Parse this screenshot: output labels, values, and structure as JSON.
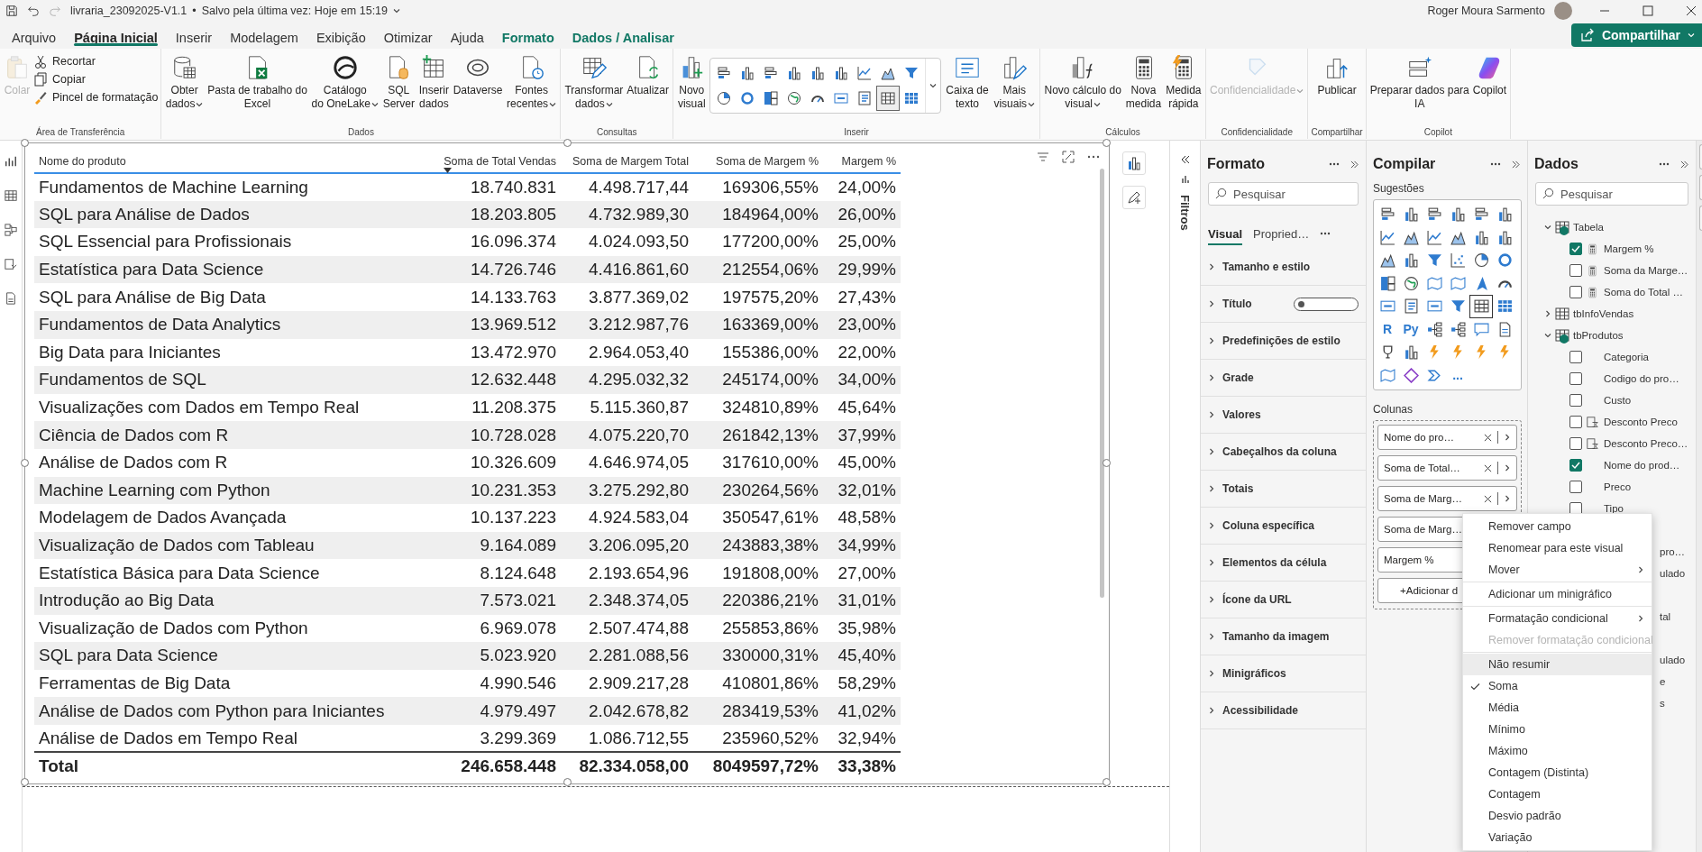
{
  "title_bar": {
    "file_name": "livraria_23092025-V1.1",
    "separator": "•",
    "saved_status": "Salvo pela última vez: Hoje em 15:19",
    "user_name": "Roger Moura Sarmento"
  },
  "menu_tabs": [
    {
      "label": "Arquivo",
      "selected": false,
      "kind": "tab"
    },
    {
      "label": "Página Inicial",
      "selected": true,
      "kind": "tab"
    },
    {
      "label": "Inserir",
      "selected": false,
      "kind": "tab"
    },
    {
      "label": "Modelagem",
      "selected": false,
      "kind": "tab"
    },
    {
      "label": "Exibição",
      "selected": false,
      "kind": "tab"
    },
    {
      "label": "Otimizar",
      "selected": false,
      "kind": "tab"
    },
    {
      "label": "Ajuda",
      "selected": false,
      "kind": "tab"
    },
    {
      "label": "Formato",
      "selected": false,
      "kind": "context"
    },
    {
      "label": "Dados / Analisar",
      "selected": false,
      "kind": "context"
    }
  ],
  "share_button": {
    "label": "Compartilhar"
  },
  "ribbon": {
    "groups": [
      {
        "label": "Área de Transferência",
        "items": [
          {
            "kind": "large",
            "lines": [
              "Colar"
            ],
            "dropdown": false,
            "disabled": true
          },
          {
            "kind": "small",
            "lines": [
              "Recortar"
            ],
            "dropdown": false,
            "disabled": false
          },
          {
            "kind": "small",
            "lines": [
              "Copiar"
            ],
            "dropdown": false,
            "disabled": false
          },
          {
            "kind": "small",
            "lines": [
              "Pincel de formatação"
            ],
            "dropdown": false,
            "disabled": false
          }
        ]
      },
      {
        "label": "Dados",
        "items": [
          {
            "kind": "large",
            "lines": [
              "Obter",
              "dados"
            ],
            "dropdown": true,
            "disabled": false
          },
          {
            "kind": "large",
            "lines": [
              "Pasta de trabalho do",
              "Excel"
            ],
            "dropdown": false,
            "disabled": false
          },
          {
            "kind": "large",
            "lines": [
              "Catálogo",
              "do OneLake"
            ],
            "dropdown": true,
            "disabled": false
          },
          {
            "kind": "large",
            "lines": [
              "SQL",
              "Server"
            ],
            "dropdown": false,
            "disabled": false
          },
          {
            "kind": "large",
            "lines": [
              "Inserir",
              "dados"
            ],
            "dropdown": false,
            "disabled": false
          },
          {
            "kind": "large",
            "lines": [
              "Dataverse"
            ],
            "dropdown": false,
            "disabled": false
          },
          {
            "kind": "large",
            "lines": [
              "Fontes",
              "recentes"
            ],
            "dropdown": true,
            "disabled": false
          }
        ]
      },
      {
        "label": "Consultas",
        "items": [
          {
            "kind": "large",
            "lines": [
              "Transformar",
              "dados"
            ],
            "dropdown": true,
            "disabled": false
          },
          {
            "kind": "large",
            "lines": [
              "Atualizar"
            ],
            "dropdown": false,
            "disabled": false
          }
        ]
      },
      {
        "label": "Inserir",
        "items": [
          {
            "kind": "large",
            "lines": [
              "Novo",
              "visual"
            ],
            "dropdown": false,
            "disabled": false
          },
          {
            "kind": "gallery",
            "dropdown": true,
            "disabled": false,
            "visuals": [
              {
                "selected": false
              },
              {
                "selected": false
              },
              {
                "selected": false
              },
              {
                "selected": false
              },
              {
                "selected": false
              },
              {
                "selected": false
              },
              {
                "selected": false
              },
              {
                "selected": false
              },
              {
                "selected": false
              },
              {
                "selected": false
              },
              {
                "selected": false
              },
              {
                "selected": false
              },
              {
                "selected": false
              },
              {
                "selected": false
              },
              {
                "selected": false
              },
              {
                "selected": false
              },
              {
                "selected": true
              },
              {
                "selected": false
              }
            ]
          },
          {
            "kind": "large",
            "lines": [
              "Caixa de",
              "texto"
            ],
            "dropdown": false,
            "disabled": false
          },
          {
            "kind": "large",
            "lines": [
              "Mais",
              "visuais"
            ],
            "dropdown": true,
            "disabled": false
          }
        ]
      },
      {
        "label": "Cálculos",
        "items": [
          {
            "kind": "large",
            "lines": [
              "Novo cálculo do",
              "visual"
            ],
            "dropdown": true,
            "disabled": false
          },
          {
            "kind": "large",
            "lines": [
              "Nova",
              "medida"
            ],
            "dropdown": false,
            "disabled": false
          },
          {
            "kind": "large",
            "lines": [
              "Medida",
              "rápida"
            ],
            "dropdown": false,
            "disabled": false
          }
        ]
      },
      {
        "label": "Confidencialidade",
        "items": [
          {
            "kind": "large",
            "lines": [
              "Confidencialidade"
            ],
            "dropdown": true,
            "disabled": true
          }
        ]
      },
      {
        "label": "Compartilhar",
        "items": [
          {
            "kind": "large",
            "lines": [
              "Publicar"
            ],
            "dropdown": false,
            "disabled": false
          }
        ]
      },
      {
        "label": "Copilot",
        "items": [
          {
            "kind": "large",
            "lines": [
              "Preparar dados para",
              "IA"
            ],
            "dropdown": false,
            "disabled": false
          },
          {
            "kind": "large",
            "lines": [
              "Copilot"
            ],
            "dropdown": false,
            "disabled": false
          }
        ]
      }
    ]
  },
  "table_visual": {
    "columns": [
      {
        "label": "Nome do produto",
        "sorted": false
      },
      {
        "label": "Soma de Total Vendas",
        "sorted": true
      },
      {
        "label": "Soma de Margem Total",
        "sorted": false
      },
      {
        "label": "Soma de Margem %",
        "sorted": false
      },
      {
        "label": "Margem %",
        "sorted": false
      }
    ],
    "rows": [
      [
        "Fundamentos de Machine Learning",
        "18.740.831",
        "4.498.717,44",
        "169306,55%",
        "24,00%"
      ],
      [
        "SQL para Análise de Dados",
        "18.203.805",
        "4.732.989,30",
        "184964,00%",
        "26,00%"
      ],
      [
        "SQL Essencial para Profissionais",
        "16.096.374",
        "4.024.093,50",
        "177200,00%",
        "25,00%"
      ],
      [
        "Estatística para Data Science",
        "14.726.746",
        "4.416.861,60",
        "212554,06%",
        "29,99%"
      ],
      [
        "SQL para Análise de Big Data",
        "14.133.763",
        "3.877.369,02",
        "197575,20%",
        "27,43%"
      ],
      [
        "Fundamentos de Data Analytics",
        "13.969.512",
        "3.212.987,76",
        "163369,00%",
        "23,00%"
      ],
      [
        "Big Data para Iniciantes",
        "13.472.970",
        "2.964.053,40",
        "155386,00%",
        "22,00%"
      ],
      [
        "Fundamentos de SQL",
        "12.632.448",
        "4.295.032,32",
        "245174,00%",
        "34,00%"
      ],
      [
        "Visualizações com Dados em Tempo Real",
        "11.208.375",
        "5.115.360,87",
        "324810,89%",
        "45,64%"
      ],
      [
        "Ciência de Dados com R",
        "10.728.028",
        "4.075.220,70",
        "261842,13%",
        "37,99%"
      ],
      [
        "Análise de Dados com R",
        "10.326.609",
        "4.646.974,05",
        "317610,00%",
        "45,00%"
      ],
      [
        "Machine Learning com Python",
        "10.231.353",
        "3.275.292,80",
        "230264,56%",
        "32,01%"
      ],
      [
        "Modelagem de Dados Avançada",
        "10.137.223",
        "4.924.583,04",
        "350547,61%",
        "48,58%"
      ],
      [
        "Visualização de Dados com Tableau",
        "9.164.089",
        "3.206.095,20",
        "243883,38%",
        "34,99%"
      ],
      [
        "Estatística Básica para Data Science",
        "8.124.648",
        "2.193.654,96",
        "191808,00%",
        "27,00%"
      ],
      [
        "Introdução ao Big Data",
        "7.573.021",
        "2.348.374,05",
        "220386,21%",
        "31,01%"
      ],
      [
        "Visualização de Dados com Python",
        "6.969.078",
        "2.507.474,88",
        "255853,86%",
        "35,98%"
      ],
      [
        "SQL para Data Science",
        "5.023.920",
        "2.281.088,56",
        "330000,31%",
        "45,40%"
      ],
      [
        "Ferramentas de Big Data",
        "4.990.546",
        "2.909.217,28",
        "410801,86%",
        "58,29%"
      ],
      [
        "Análise de Dados com Python para Iniciantes",
        "4.979.497",
        "2.042.678,82",
        "283419,53%",
        "41,02%"
      ],
      [
        "Análise de Dados em Tempo Real",
        "3.299.369",
        "1.086.712,55",
        "235960,52%",
        "32,94%"
      ]
    ],
    "total": [
      "Total",
      "246.658.448",
      "82.334.058,00",
      "8049597,72%",
      "33,38%"
    ]
  },
  "filters_pane": {
    "label": "Filtros"
  },
  "format_pane": {
    "title": "Formato",
    "search_placeholder": "Pesquisar",
    "tabs": [
      {
        "label": "Visual",
        "selected": true
      },
      {
        "label": "Propried…",
        "selected": false
      }
    ],
    "sections": [
      {
        "label": "Tamanho e estilo",
        "kind": "section"
      },
      {
        "label": "Título",
        "kind": "toggle",
        "on": false
      },
      {
        "label": "Predefinições de estilo",
        "kind": "section"
      },
      {
        "label": "Grade",
        "kind": "section"
      },
      {
        "label": "Valores",
        "kind": "section"
      },
      {
        "label": "Cabeçalhos da coluna",
        "kind": "section"
      },
      {
        "label": "Totais",
        "kind": "section"
      },
      {
        "label": "Coluna específica",
        "kind": "section"
      },
      {
        "label": "Elementos da célula",
        "kind": "section"
      },
      {
        "label": "Ícone da URL",
        "kind": "section"
      },
      {
        "label": "Tamanho da imagem",
        "kind": "section"
      },
      {
        "label": "Minigráficos",
        "kind": "section"
      },
      {
        "label": "Acessibilidade",
        "kind": "section"
      }
    ]
  },
  "build_pane": {
    "title": "Compilar",
    "suggestions_label": "Sugestões",
    "visuals": [
      {
        "selected": false
      },
      {
        "selected": false
      },
      {
        "selected": false
      },
      {
        "selected": false
      },
      {
        "selected": false
      },
      {
        "selected": false
      },
      {
        "selected": false
      },
      {
        "selected": false
      },
      {
        "selected": false
      },
      {
        "selected": false
      },
      {
        "selected": false
      },
      {
        "selected": false
      },
      {
        "selected": false
      },
      {
        "selected": false
      },
      {
        "selected": false
      },
      {
        "selected": false
      },
      {
        "selected": false
      },
      {
        "selected": false
      },
      {
        "selected": false
      },
      {
        "selected": false
      },
      {
        "selected": false
      },
      {
        "selected": false
      },
      {
        "selected": false
      },
      {
        "selected": false
      },
      {
        "selected": false
      },
      {
        "selected": false
      },
      {
        "selected": false
      },
      {
        "selected": false
      },
      {
        "selected": true
      },
      {
        "selected": false
      },
      {
        "glyph": "R",
        "selected": false
      },
      {
        "glyph": "Py",
        "selected": false
      },
      {
        "selected": false
      },
      {
        "selected": false
      },
      {
        "selected": false
      },
      {
        "selected": false
      },
      {
        "selected": false
      },
      {
        "selected": false
      },
      {
        "selected": false
      },
      {
        "selected": false
      },
      {
        "selected": false
      },
      {
        "selected": false
      },
      {
        "selected": false
      },
      {
        "selected": false
      },
      {
        "selected": false
      },
      {
        "glyph": "...",
        "selected": false
      }
    ],
    "columns_label": "Colunas",
    "fields": [
      {
        "label": "Nome do pro…"
      },
      {
        "label": "Soma de Total…"
      },
      {
        "label": "Soma de Marg…"
      },
      {
        "label": "Soma de Marg…"
      },
      {
        "label": "Margem %"
      }
    ],
    "add_field": "+Adicionar d"
  },
  "data_pane": {
    "title": "Dados",
    "search_placeholder": "Pesquisar",
    "tables": [
      {
        "label": "Tabela",
        "expanded": true,
        "in_use": true,
        "children": [
          {
            "label": "Margem %",
            "checked": true,
            "kind": "measure"
          },
          {
            "label": "Soma da Marge…",
            "checked": false,
            "kind": "measure"
          },
          {
            "label": "Soma do Total …",
            "checked": false,
            "kind": "measure"
          }
        ]
      },
      {
        "label": "tbInfoVendas",
        "expanded": false,
        "in_use": false
      },
      {
        "label": "tbProdutos",
        "expanded": true,
        "in_use": true,
        "children": [
          {
            "label": "Categoria",
            "checked": false,
            "kind": "column"
          },
          {
            "label": "Codigo do pro…",
            "checked": false,
            "kind": "column"
          },
          {
            "label": "Custo",
            "checked": false,
            "kind": "column"
          },
          {
            "label": "Desconto Preco",
            "checked": false,
            "kind": "calculated"
          },
          {
            "label": "Desconto Preco…",
            "checked": false,
            "kind": "calculated"
          },
          {
            "label": "Nome do prod…",
            "checked": true,
            "kind": "column"
          },
          {
            "label": "Preco",
            "checked": false,
            "kind": "column"
          },
          {
            "label": "Tipo",
            "checked": false,
            "kind": "column"
          }
        ]
      }
    ],
    "covered_fragments": [
      "pro…",
      "ulado",
      "tal",
      "ulado",
      "e",
      "s"
    ]
  },
  "context_menu": {
    "items": [
      {
        "label": "Remover campo",
        "kind": "item",
        "checked": false,
        "highlighted": false,
        "disabled": false,
        "separator_before": false
      },
      {
        "label": "Renomear para este visual",
        "kind": "item",
        "checked": false,
        "highlighted": false,
        "disabled": false,
        "separator_before": false
      },
      {
        "label": "Mover",
        "kind": "submenu",
        "checked": false,
        "highlighted": false,
        "disabled": false,
        "separator_before": false
      },
      {
        "label": "Adicionar um minigráfico",
        "kind": "item",
        "checked": false,
        "highlighted": false,
        "disabled": false,
        "separator_before": true
      },
      {
        "label": "Formatação condicional",
        "kind": "submenu",
        "checked": false,
        "highlighted": false,
        "disabled": false,
        "separator_before": true
      },
      {
        "label": "Remover formatação condicional",
        "kind": "item",
        "checked": false,
        "highlighted": false,
        "disabled": true,
        "separator_before": false
      },
      {
        "label": "Não resumir",
        "kind": "item",
        "checked": false,
        "highlighted": true,
        "disabled": false,
        "separator_before": true
      },
      {
        "label": "Soma",
        "kind": "item",
        "checked": true,
        "highlighted": false,
        "disabled": false,
        "separator_before": false
      },
      {
        "label": "Média",
        "kind": "item",
        "checked": false,
        "highlighted": false,
        "disabled": false,
        "separator_before": false
      },
      {
        "label": "Mínimo",
        "kind": "item",
        "checked": false,
        "highlighted": false,
        "disabled": false,
        "separator_before": false
      },
      {
        "label": "Máximo",
        "kind": "item",
        "checked": false,
        "highlighted": false,
        "disabled": false,
        "separator_before": false
      },
      {
        "label": "Contagem (Distinta)",
        "kind": "item",
        "checked": false,
        "highlighted": false,
        "disabled": false,
        "separator_before": false
      },
      {
        "label": "Contagem",
        "kind": "item",
        "checked": false,
        "highlighted": false,
        "disabled": false,
        "separator_before": false
      },
      {
        "label": "Desvio padrão",
        "kind": "item",
        "checked": false,
        "highlighted": false,
        "disabled": false,
        "separator_before": false
      },
      {
        "label": "Variação",
        "kind": "item",
        "checked": false,
        "highlighted": false,
        "disabled": false,
        "separator_before": false
      }
    ]
  }
}
